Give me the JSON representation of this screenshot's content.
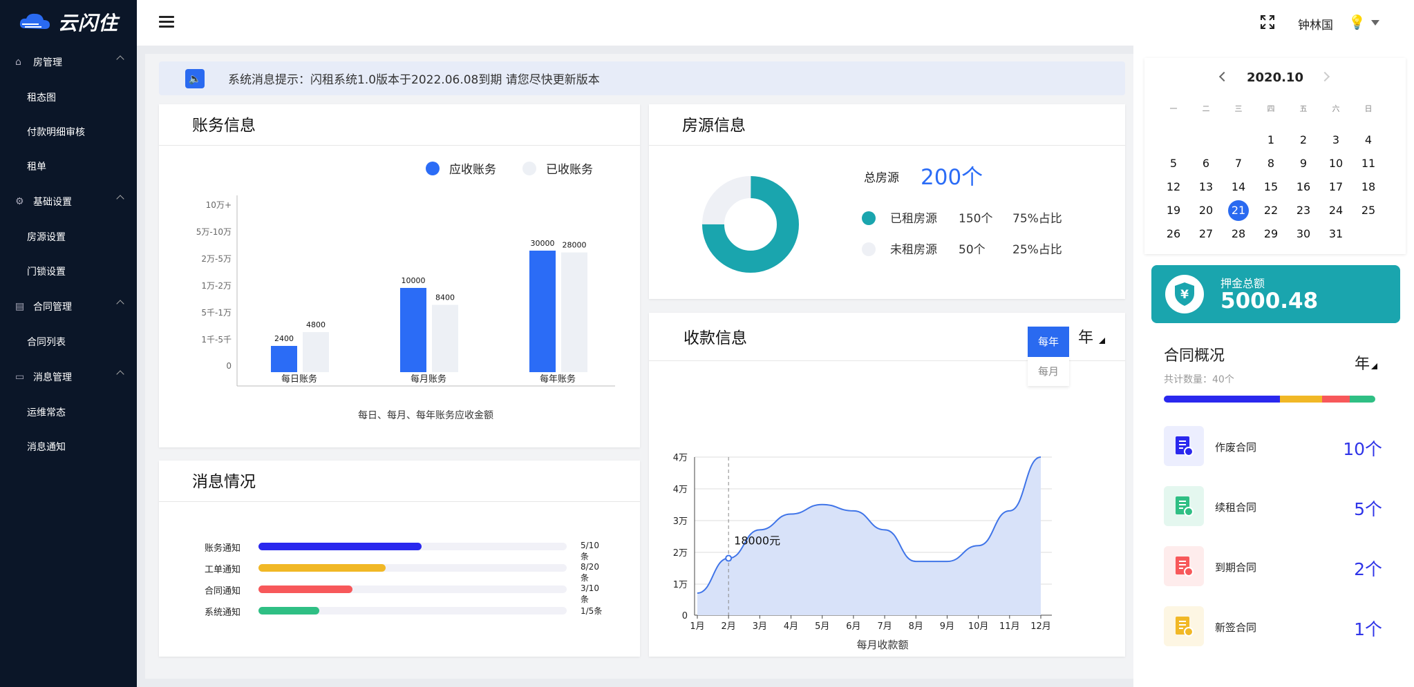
{
  "app": {
    "logo_text": "云闪住"
  },
  "sidebar": {
    "groups": [
      {
        "label": "房管理",
        "icon": "home-icon",
        "items": [
          "租态图",
          "付款明细审核",
          "租单"
        ]
      },
      {
        "label": "基础设置",
        "icon": "gear-icon",
        "items": [
          "房源设置",
          "门锁设置"
        ]
      },
      {
        "label": "合同管理",
        "icon": "contract-icon",
        "items": [
          "合同列表"
        ]
      },
      {
        "label": "消息管理",
        "icon": "message-icon",
        "items": [
          "运维常态",
          "消息通知"
        ]
      }
    ]
  },
  "header": {
    "user_name": "钟林国"
  },
  "notice": {
    "text": "系统消息提示：闪租系统1.0版本于2022.06.08到期 请您尽快更新版本"
  },
  "billing": {
    "title": "账务信息",
    "legend": [
      "应收账务",
      "已收账务"
    ],
    "colors": {
      "receivable": "#2b6cf6",
      "received": "#edf0f5"
    }
  },
  "housing": {
    "title": "房源信息",
    "total_label": "总房源",
    "total_value": "200个",
    "rows": [
      {
        "label": "已租房源",
        "count": "150个",
        "pct": "75%占比",
        "color": "#1aa5ae"
      },
      {
        "label": "未租房源",
        "count": "50个",
        "pct": "25%占比",
        "color": "#eef0f5"
      }
    ]
  },
  "payment": {
    "title": "收款信息",
    "period_options": [
      "每年",
      "每月"
    ],
    "period_selected": "年",
    "tooltip": "18000元"
  },
  "messages": {
    "title": "消息情况",
    "rows": [
      {
        "label": "账务通知",
        "count": "5/10条",
        "ratio": 0.5,
        "color": "#2a28ee"
      },
      {
        "label": "工单通知",
        "count": "8/20条",
        "ratio": 0.4,
        "color": "#f1b826"
      },
      {
        "label": "合同通知",
        "count": "3/10条",
        "ratio": 0.3,
        "color": "#f7585a"
      },
      {
        "label": "系统通知",
        "count": "1/5条",
        "ratio": 0.2,
        "color": "#2fbf84"
      }
    ]
  },
  "calendar": {
    "month": "2020.10",
    "weekdays": [
      "一",
      "二",
      "三",
      "四",
      "五",
      "六",
      "日"
    ],
    "first_weekday_index": 3,
    "days": 31,
    "selected": 21
  },
  "deposit": {
    "label": "押金总额",
    "value": "5000.48"
  },
  "contracts": {
    "title": "合同概况",
    "period": "年",
    "count_text": "共计数量：40个",
    "bar": [
      {
        "ratio": 0.55,
        "color": "#2a28ee"
      },
      {
        "ratio": 0.2,
        "color": "#f1b826"
      },
      {
        "ratio": 0.13,
        "color": "#f7585a"
      },
      {
        "ratio": 0.12,
        "color": "#2fbf84"
      }
    ],
    "rows": [
      {
        "label": "作废合同",
        "value": "10个",
        "icon": "void-contract-icon",
        "bg": "#eceefe",
        "fg": "#2a28ee"
      },
      {
        "label": "续租合同",
        "value": "5个",
        "icon": "renew-contract-icon",
        "bg": "#e4f7ef",
        "fg": "#2fbf84"
      },
      {
        "label": "到期合同",
        "value": "2个",
        "icon": "expired-contract-icon",
        "bg": "#feecec",
        "fg": "#f7585a"
      },
      {
        "label": "新签合同",
        "value": "1个",
        "icon": "new-contract-icon",
        "bg": "#fdf6e3",
        "fg": "#f1b826"
      }
    ]
  },
  "chart_data": [
    {
      "type": "bar",
      "title": "",
      "xlabel": "每日、每月、每年账务应收金额",
      "y_ticks": [
        "0",
        "1千-5千",
        "5千-1万",
        "1万-2万",
        "2万-5万",
        "5万-10万",
        "10万+"
      ],
      "categories": [
        "每日账务",
        "每月账务",
        "每年账务"
      ],
      "series": [
        {
          "name": "应收账务",
          "values": [
            2400,
            10000,
            30000
          ]
        },
        {
          "name": "已收账务",
          "values": [
            4800,
            8400,
            28000
          ]
        }
      ]
    },
    {
      "type": "pie",
      "slices": [
        {
          "name": "已租房源",
          "value": 150
        },
        {
          "name": "未租房源",
          "value": 50
        }
      ]
    },
    {
      "type": "area",
      "xlabel": "每月收款额",
      "x": [
        "1月",
        "2月",
        "3月",
        "4月",
        "5月",
        "6月",
        "7月",
        "8月",
        "9月",
        "10月",
        "11月",
        "12月"
      ],
      "y_ticks": [
        "0",
        "1万",
        "2万",
        "3万",
        "4万",
        "4万"
      ],
      "values": [
        7000,
        18000,
        27000,
        32000,
        35000,
        33000,
        27000,
        17000,
        17000,
        22000,
        33000,
        50000
      ],
      "ylim": [
        0,
        50000
      ]
    }
  ]
}
